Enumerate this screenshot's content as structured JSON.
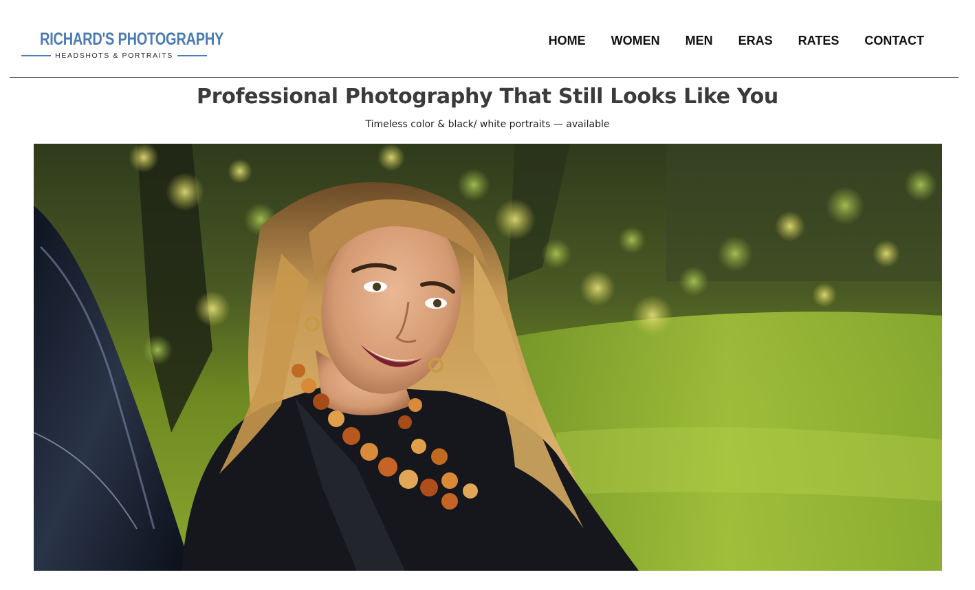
{
  "logo": {
    "title": "RICHARD'S PHOTOGRAPHY",
    "subtitle": "HEADSHOTS & PORTRAITS",
    "color": "#4a7bb3"
  },
  "nav": {
    "items": [
      {
        "label": "HOME"
      },
      {
        "label": "WOMEN"
      },
      {
        "label": "MEN"
      },
      {
        "label": "ERAS"
      },
      {
        "label": "RATES"
      },
      {
        "label": "CONTACT"
      }
    ]
  },
  "hero": {
    "title": "Professional Photography That Still Looks Like You",
    "subtitle": "Timeless color & black/ white portraits — available",
    "photo_icon": "portrait-photo"
  }
}
